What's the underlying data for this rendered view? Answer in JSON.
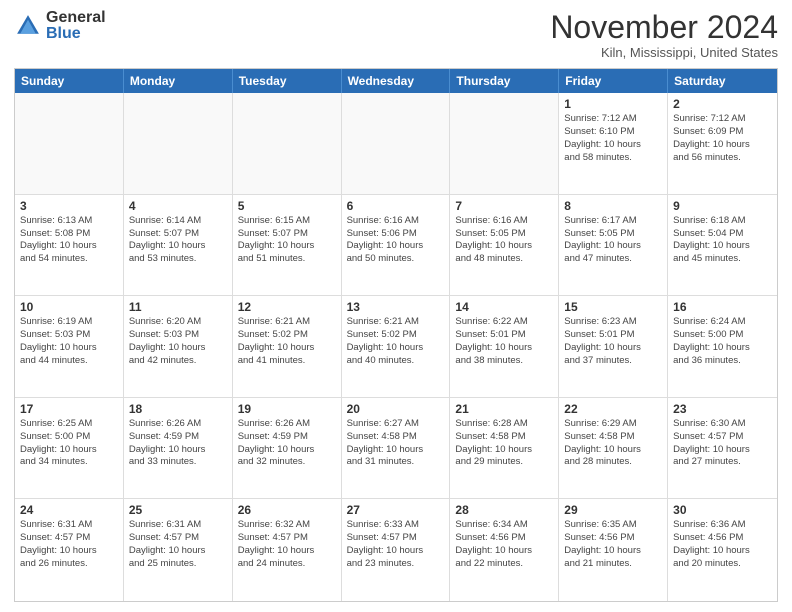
{
  "header": {
    "logo_general": "General",
    "logo_blue": "Blue",
    "month_title": "November 2024",
    "location": "Kiln, Mississippi, United States"
  },
  "calendar": {
    "days_of_week": [
      "Sunday",
      "Monday",
      "Tuesday",
      "Wednesday",
      "Thursday",
      "Friday",
      "Saturday"
    ],
    "weeks": [
      [
        {
          "day": "",
          "info": ""
        },
        {
          "day": "",
          "info": ""
        },
        {
          "day": "",
          "info": ""
        },
        {
          "day": "",
          "info": ""
        },
        {
          "day": "",
          "info": ""
        },
        {
          "day": "1",
          "info": "Sunrise: 7:12 AM\nSunset: 6:10 PM\nDaylight: 10 hours\nand 58 minutes."
        },
        {
          "day": "2",
          "info": "Sunrise: 7:12 AM\nSunset: 6:09 PM\nDaylight: 10 hours\nand 56 minutes."
        }
      ],
      [
        {
          "day": "3",
          "info": "Sunrise: 6:13 AM\nSunset: 5:08 PM\nDaylight: 10 hours\nand 54 minutes."
        },
        {
          "day": "4",
          "info": "Sunrise: 6:14 AM\nSunset: 5:07 PM\nDaylight: 10 hours\nand 53 minutes."
        },
        {
          "day": "5",
          "info": "Sunrise: 6:15 AM\nSunset: 5:07 PM\nDaylight: 10 hours\nand 51 minutes."
        },
        {
          "day": "6",
          "info": "Sunrise: 6:16 AM\nSunset: 5:06 PM\nDaylight: 10 hours\nand 50 minutes."
        },
        {
          "day": "7",
          "info": "Sunrise: 6:16 AM\nSunset: 5:05 PM\nDaylight: 10 hours\nand 48 minutes."
        },
        {
          "day": "8",
          "info": "Sunrise: 6:17 AM\nSunset: 5:05 PM\nDaylight: 10 hours\nand 47 minutes."
        },
        {
          "day": "9",
          "info": "Sunrise: 6:18 AM\nSunset: 5:04 PM\nDaylight: 10 hours\nand 45 minutes."
        }
      ],
      [
        {
          "day": "10",
          "info": "Sunrise: 6:19 AM\nSunset: 5:03 PM\nDaylight: 10 hours\nand 44 minutes."
        },
        {
          "day": "11",
          "info": "Sunrise: 6:20 AM\nSunset: 5:03 PM\nDaylight: 10 hours\nand 42 minutes."
        },
        {
          "day": "12",
          "info": "Sunrise: 6:21 AM\nSunset: 5:02 PM\nDaylight: 10 hours\nand 41 minutes."
        },
        {
          "day": "13",
          "info": "Sunrise: 6:21 AM\nSunset: 5:02 PM\nDaylight: 10 hours\nand 40 minutes."
        },
        {
          "day": "14",
          "info": "Sunrise: 6:22 AM\nSunset: 5:01 PM\nDaylight: 10 hours\nand 38 minutes."
        },
        {
          "day": "15",
          "info": "Sunrise: 6:23 AM\nSunset: 5:01 PM\nDaylight: 10 hours\nand 37 minutes."
        },
        {
          "day": "16",
          "info": "Sunrise: 6:24 AM\nSunset: 5:00 PM\nDaylight: 10 hours\nand 36 minutes."
        }
      ],
      [
        {
          "day": "17",
          "info": "Sunrise: 6:25 AM\nSunset: 5:00 PM\nDaylight: 10 hours\nand 34 minutes."
        },
        {
          "day": "18",
          "info": "Sunrise: 6:26 AM\nSunset: 4:59 PM\nDaylight: 10 hours\nand 33 minutes."
        },
        {
          "day": "19",
          "info": "Sunrise: 6:26 AM\nSunset: 4:59 PM\nDaylight: 10 hours\nand 32 minutes."
        },
        {
          "day": "20",
          "info": "Sunrise: 6:27 AM\nSunset: 4:58 PM\nDaylight: 10 hours\nand 31 minutes."
        },
        {
          "day": "21",
          "info": "Sunrise: 6:28 AM\nSunset: 4:58 PM\nDaylight: 10 hours\nand 29 minutes."
        },
        {
          "day": "22",
          "info": "Sunrise: 6:29 AM\nSunset: 4:58 PM\nDaylight: 10 hours\nand 28 minutes."
        },
        {
          "day": "23",
          "info": "Sunrise: 6:30 AM\nSunset: 4:57 PM\nDaylight: 10 hours\nand 27 minutes."
        }
      ],
      [
        {
          "day": "24",
          "info": "Sunrise: 6:31 AM\nSunset: 4:57 PM\nDaylight: 10 hours\nand 26 minutes."
        },
        {
          "day": "25",
          "info": "Sunrise: 6:31 AM\nSunset: 4:57 PM\nDaylight: 10 hours\nand 25 minutes."
        },
        {
          "day": "26",
          "info": "Sunrise: 6:32 AM\nSunset: 4:57 PM\nDaylight: 10 hours\nand 24 minutes."
        },
        {
          "day": "27",
          "info": "Sunrise: 6:33 AM\nSunset: 4:57 PM\nDaylight: 10 hours\nand 23 minutes."
        },
        {
          "day": "28",
          "info": "Sunrise: 6:34 AM\nSunset: 4:56 PM\nDaylight: 10 hours\nand 22 minutes."
        },
        {
          "day": "29",
          "info": "Sunrise: 6:35 AM\nSunset: 4:56 PM\nDaylight: 10 hours\nand 21 minutes."
        },
        {
          "day": "30",
          "info": "Sunrise: 6:36 AM\nSunset: 4:56 PM\nDaylight: 10 hours\nand 20 minutes."
        }
      ]
    ]
  }
}
